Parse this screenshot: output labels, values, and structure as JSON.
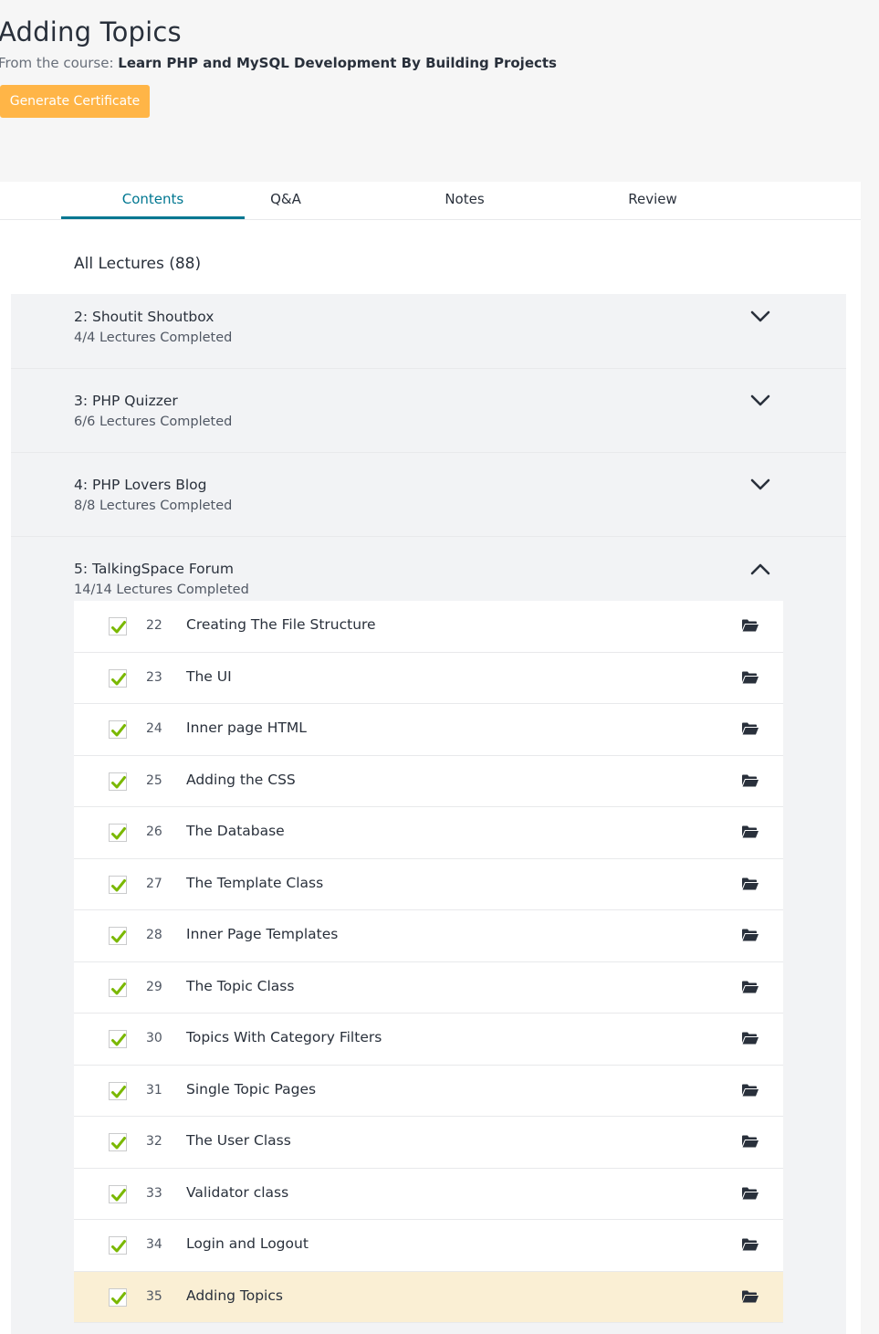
{
  "header": {
    "title": "Adding Topics",
    "course_prefix": "From the course: ",
    "course_name": "Learn PHP and MySQL Development By Building Projects",
    "cert_button": "Generate Certificate"
  },
  "tabs": {
    "contents": "Contents",
    "qa": "Q&A",
    "notes": "Notes",
    "review": "Review"
  },
  "all_lectures": "All Lectures (88)",
  "sections": [
    {
      "title": "2: Shoutit Shoutbox",
      "progress": "4/4 Lectures Completed",
      "expanded": false
    },
    {
      "title": "3: PHP Quizzer",
      "progress": "6/6 Lectures Completed",
      "expanded": false
    },
    {
      "title": "4: PHP Lovers Blog",
      "progress": "8/8 Lectures Completed",
      "expanded": false
    },
    {
      "title": "5: TalkingSpace Forum",
      "progress": "14/14 Lectures Completed",
      "expanded": true
    }
  ],
  "lectures": [
    {
      "num": "22",
      "title": "Creating The File Structure"
    },
    {
      "num": "23",
      "title": "The UI"
    },
    {
      "num": "24",
      "title": "Inner page HTML"
    },
    {
      "num": "25",
      "title": "Adding the CSS"
    },
    {
      "num": "26",
      "title": "The Database"
    },
    {
      "num": "27",
      "title": "The Template Class"
    },
    {
      "num": "28",
      "title": "Inner Page Templates"
    },
    {
      "num": "29",
      "title": "The Topic Class"
    },
    {
      "num": "30",
      "title": "Topics With Category Filters"
    },
    {
      "num": "31",
      "title": "Single Topic Pages"
    },
    {
      "num": "32",
      "title": "The User Class"
    },
    {
      "num": "33",
      "title": "Validator class"
    },
    {
      "num": "34",
      "title": "Login and Logout"
    },
    {
      "num": "35",
      "title": "Adding Topics"
    }
  ],
  "colors": {
    "accent": "#007791",
    "cert_button": "#ffb547",
    "check": "#7ab800",
    "current_row": "#faefd4"
  }
}
